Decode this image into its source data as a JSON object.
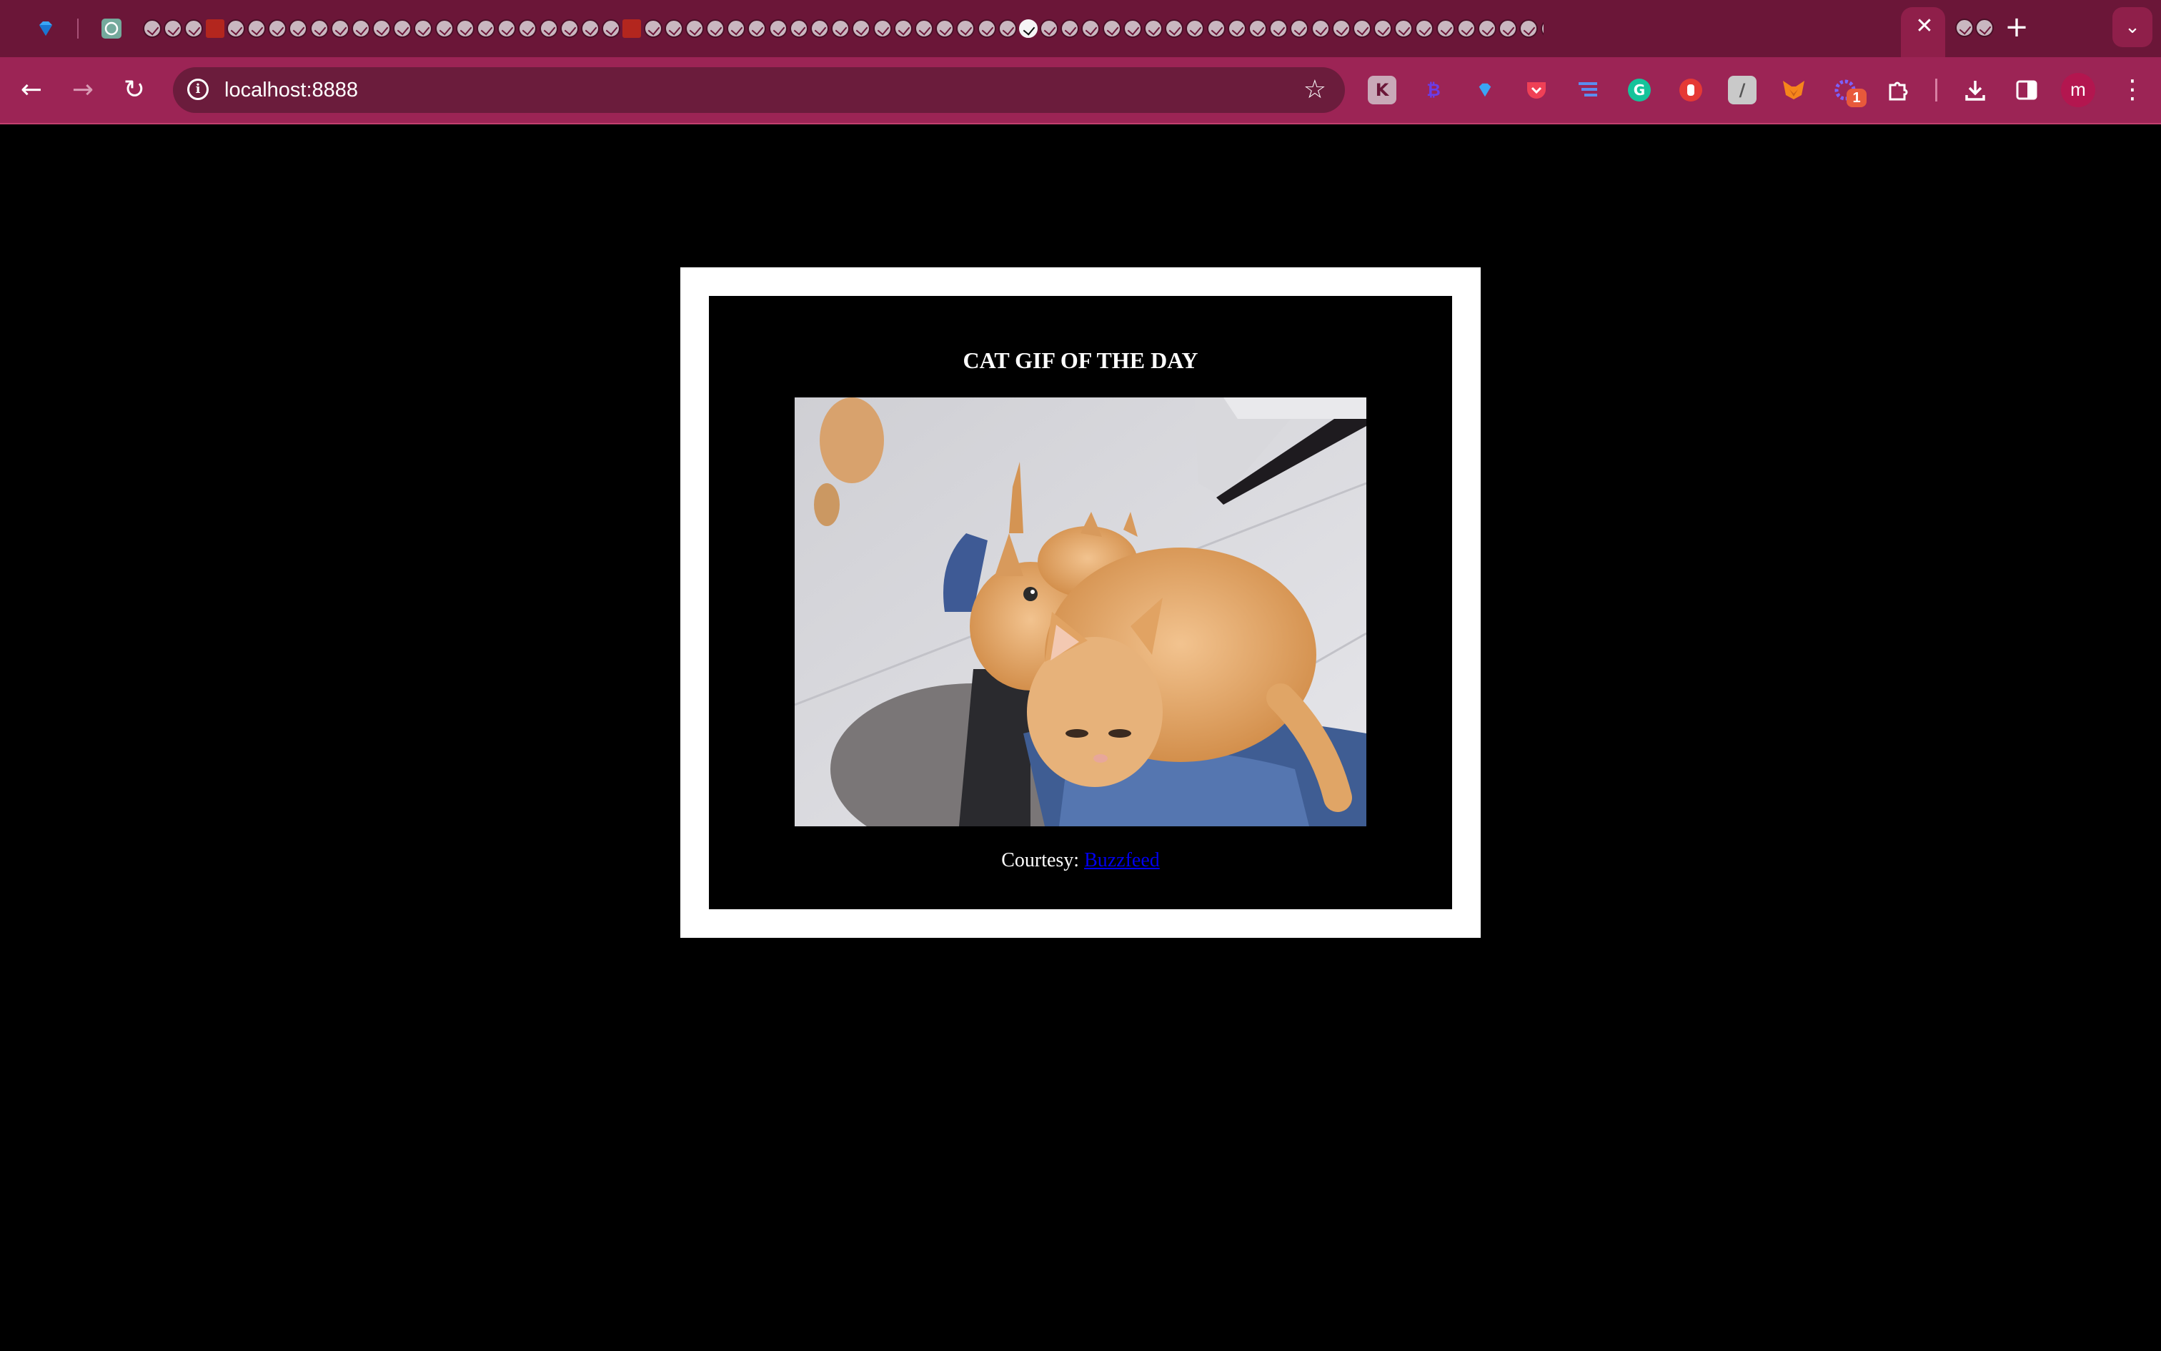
{
  "browser": {
    "address_bar": {
      "url": "localhost:8888"
    },
    "tabs": {
      "active_tab_close": "✕",
      "new_tab": "+"
    },
    "extension_badge": "1",
    "profile_initial": "m",
    "theme_colors": {
      "tab_strip": "#6b1638",
      "toolbar": "#9c2455",
      "omnibox": "#6b1c3c"
    }
  },
  "page": {
    "title": "CAT GIF OF THE DAY",
    "credit_prefix": "Courtesy: ",
    "credit_link_text": "Buzzfeed",
    "image": "cat-gif",
    "colors": {
      "background": "#000000",
      "frame": "#ffffff",
      "link": "#0000ee"
    }
  }
}
